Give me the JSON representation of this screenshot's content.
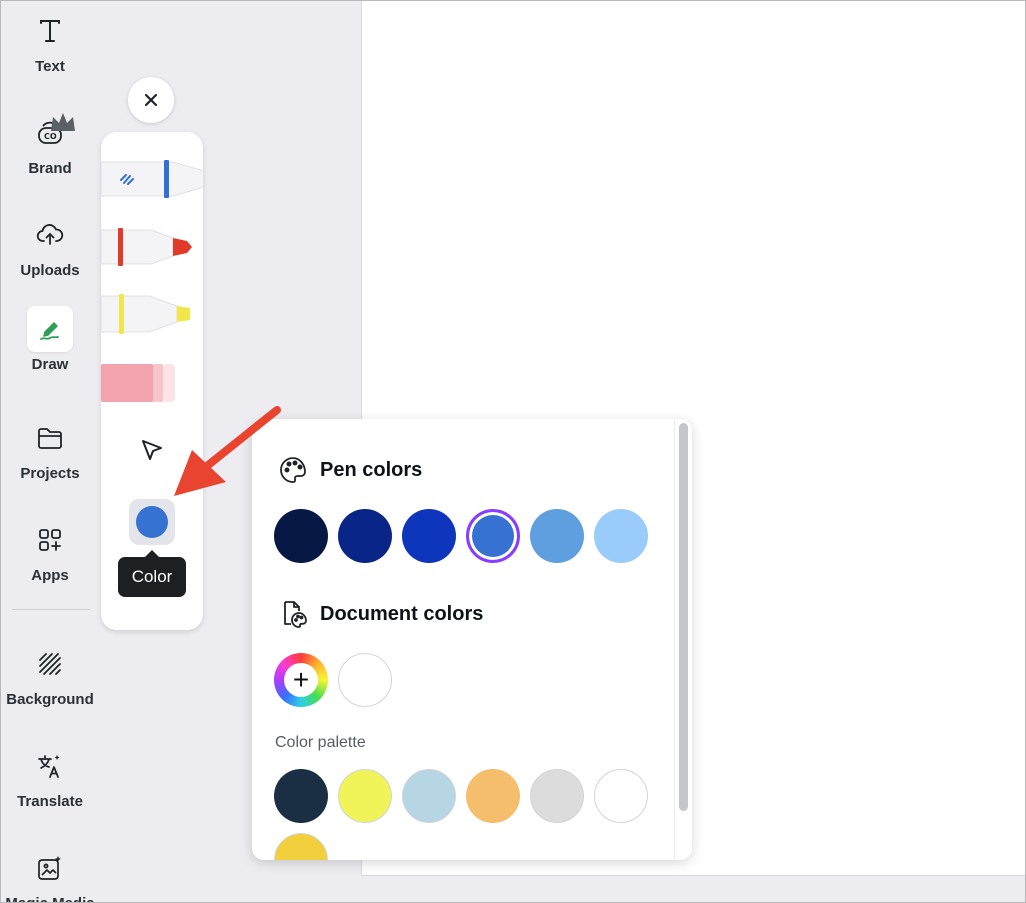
{
  "rail": {
    "items": [
      {
        "label": "Text",
        "icon": "text-icon"
      },
      {
        "label": "Brand",
        "icon": "brand-icon"
      },
      {
        "label": "Uploads",
        "icon": "cloud-upload-icon"
      },
      {
        "label": "Draw",
        "icon": "draw-icon"
      },
      {
        "label": "Projects",
        "icon": "folder-icon"
      },
      {
        "label": "Apps",
        "icon": "apps-icon"
      },
      {
        "label": "Background",
        "icon": "background-icon"
      },
      {
        "label": "Translate",
        "icon": "translate-icon"
      },
      {
        "label": "Magic Media",
        "icon": "magic-media-icon"
      }
    ],
    "active": "Draw"
  },
  "draw_toolbar": {
    "tools": [
      {
        "name": "pen",
        "color": "#2f6fd6"
      },
      {
        "name": "marker",
        "color": "#e23a2a"
      },
      {
        "name": "highlighter",
        "color": "#f3e64a"
      },
      {
        "name": "eraser",
        "color": "#f2a3ae"
      }
    ],
    "current_color": "#3572d1",
    "tooltip": "Color"
  },
  "color_panel": {
    "pen_colors_title": "Pen colors",
    "pen_colors": [
      "#061844",
      "#0a2588",
      "#0e36bd",
      "#3572d1",
      "#5f9fe0",
      "#99cbfb"
    ],
    "selected_pen_color": "#3572d1",
    "document_colors_title": "Document colors",
    "document_colors": [
      "#ffffff"
    ],
    "add_color_symbol": "+",
    "palette_label": "Color palette",
    "palette_colors": [
      "#1b2f44",
      "#f0f458",
      "#b7d6e3",
      "#f4be6c",
      "#dcdcdc",
      "#ffffff",
      "#f2cf3d"
    ]
  },
  "accent": "#8b3dff",
  "annotation_arrow_color": "#e8442f"
}
